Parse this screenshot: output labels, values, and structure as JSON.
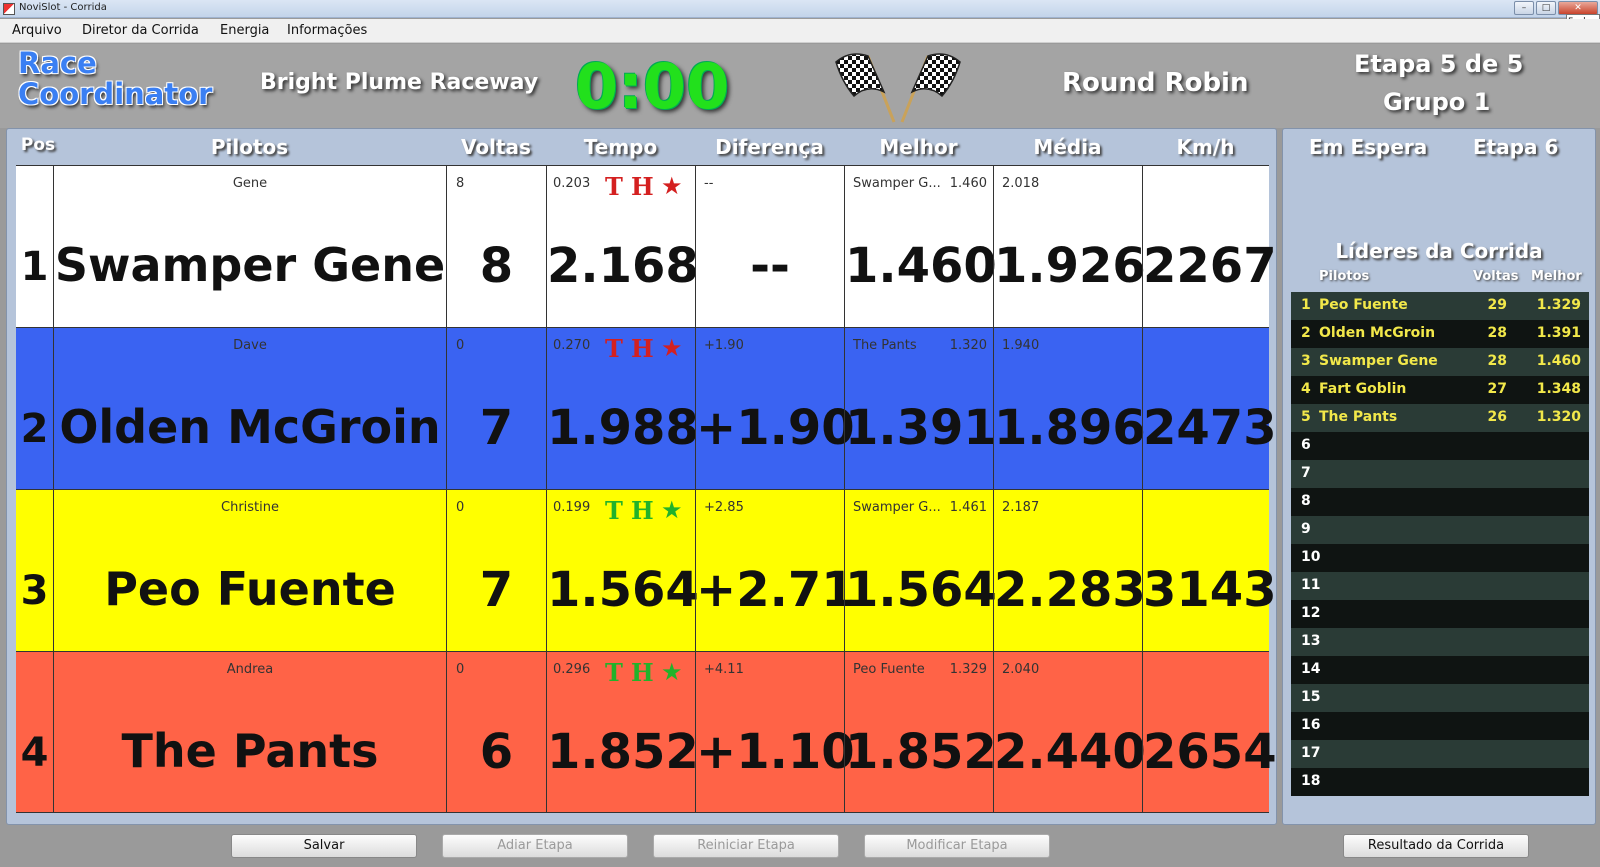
{
  "window": {
    "title": "NoviSlot - Corrida",
    "close_tooltip": "Fechar",
    "min_glyph": "–",
    "max_glyph": "□",
    "close_glyph": "✕"
  },
  "menu": [
    "Arquivo",
    "Diretor da Corrida",
    "Energia",
    "Informações"
  ],
  "header": {
    "logo_line1": "Race",
    "logo_line2": "Coordinator",
    "track": "Bright Plume Raceway",
    "clock": "0:00",
    "format": "Round Robin",
    "stage": "Etapa 5 de 5",
    "group": "Grupo 1"
  },
  "columns": {
    "pos": "Pos",
    "pilots": "Pilotos",
    "laps": "Voltas",
    "time": "Tempo",
    "diff": "Diferença",
    "best": "Melhor",
    "avg": "Média",
    "kmh": "Km/h"
  },
  "lanes": [
    {
      "color": "#ffffff",
      "pos": "1",
      "driver_small": "Gene",
      "driver": "Swamper Gene",
      "laps_small": "8",
      "laps": "8",
      "time_small": "0.203",
      "time": "2.168",
      "diff_small": "--",
      "diff": "--",
      "best_small_name": "Swamper G...",
      "best_small_val": "1.460",
      "best": "1.460",
      "avg_small": "2.018",
      "avg": "1.926",
      "kmh": "2267",
      "indicator_color": "#d42020",
      "indicators": [
        "T",
        "H",
        "★"
      ]
    },
    {
      "color": "#3a63f2",
      "pos": "2",
      "driver_small": "Dave",
      "driver": "Olden McGroin",
      "laps_small": "0",
      "laps": "7",
      "time_small": "0.270",
      "time": "1.988",
      "diff_small": "+1.90",
      "diff": "+1.90",
      "best_small_name": "The Pants",
      "best_small_val": "1.320",
      "best": "1.391",
      "avg_small": "1.940",
      "avg": "1.896",
      "kmh": "2473",
      "indicator_color": "#d42020",
      "indicators": [
        "T",
        "H",
        "★"
      ]
    },
    {
      "color": "#ffff00",
      "pos": "3",
      "driver_small": "Christine",
      "driver": "Peo Fuente",
      "laps_small": "0",
      "laps": "7",
      "time_small": "0.199",
      "time": "1.564",
      "diff_small": "+2.85",
      "diff": "+2.71",
      "best_small_name": "Swamper G...",
      "best_small_val": "1.461",
      "best": "1.564",
      "avg_small": "2.187",
      "avg": "2.283",
      "kmh": "3143",
      "indicator_color": "#22b22a",
      "indicators": [
        "T",
        "H",
        "★"
      ]
    },
    {
      "color": "#ff6347",
      "pos": "4",
      "driver_small": "Andrea",
      "driver": "The Pants",
      "laps_small": "0",
      "laps": "6",
      "time_small": "0.296",
      "time": "1.852",
      "diff_small": "+4.11",
      "diff": "+1.10",
      "best_small_name": "Peo Fuente",
      "best_small_val": "1.329",
      "best": "1.852",
      "avg_small": "2.040",
      "avg": "2.440",
      "kmh": "2654",
      "indicator_color": "#22b22a",
      "indicators": [
        "T",
        "H",
        "★"
      ]
    }
  ],
  "side": {
    "waiting": "Em Espera",
    "next_stage": "Etapa 6",
    "leaders_title": "Líderes da Corrida",
    "col_pilots": "Pilotos",
    "col_laps": "Voltas",
    "col_best": "Melhor",
    "leaders": [
      {
        "rank": "1",
        "name": "Peo Fuente",
        "laps": "29",
        "best": "1.329"
      },
      {
        "rank": "2",
        "name": "Olden McGroin",
        "laps": "28",
        "best": "1.391"
      },
      {
        "rank": "3",
        "name": "Swamper Gene",
        "laps": "28",
        "best": "1.460"
      },
      {
        "rank": "4",
        "name": "Fart Goblin",
        "laps": "27",
        "best": "1.348"
      },
      {
        "rank": "5",
        "name": "The Pants",
        "laps": "26",
        "best": "1.320"
      },
      {
        "rank": "6"
      },
      {
        "rank": "7"
      },
      {
        "rank": "8"
      },
      {
        "rank": "9"
      },
      {
        "rank": "10"
      },
      {
        "rank": "11"
      },
      {
        "rank": "12"
      },
      {
        "rank": "13"
      },
      {
        "rank": "14"
      },
      {
        "rank": "15"
      },
      {
        "rank": "16"
      },
      {
        "rank": "17"
      },
      {
        "rank": "18"
      }
    ]
  },
  "buttons": {
    "save": "Salvar",
    "postpone": "Adiar Etapa",
    "restart": "Reiniciar Etapa",
    "modify": "Modificar Etapa",
    "result": "Resultado da Corrida"
  }
}
